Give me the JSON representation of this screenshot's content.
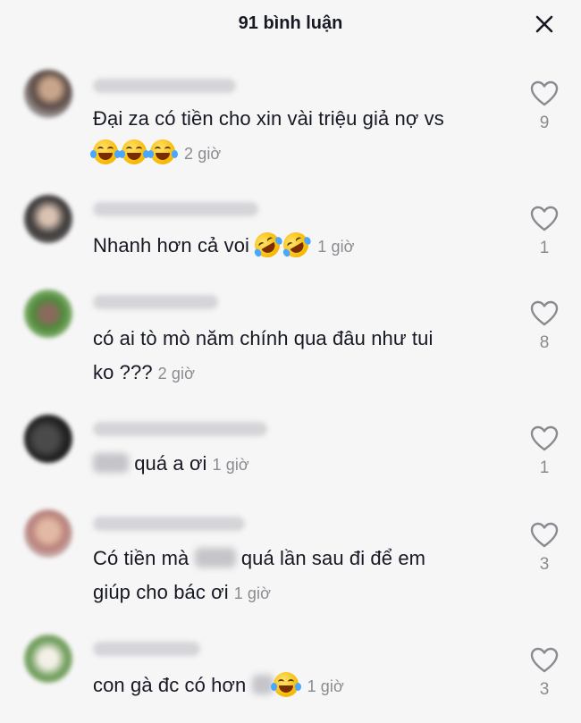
{
  "header": {
    "title": "91 bình luận",
    "close_icon": "close-icon"
  },
  "comments": [
    {
      "text": "Đại za có tiền cho xin vài triệu giả nợ vs",
      "emojis": [
        "face-with-tears-of-joy",
        "face-with-tears-of-joy",
        "face-with-tears-of-joy"
      ],
      "time": "2 giờ",
      "likes": "9"
    },
    {
      "text": "Nhanh hơn cả voi",
      "emojis": [
        "rolling-on-the-floor-laughing",
        "rolling-on-the-floor-laughing"
      ],
      "time": "1 giờ",
      "likes": "1"
    },
    {
      "text_line1": "có ai tò mò năm chính qua đâu như tui",
      "text_line2": "ko ???",
      "time": "2 giờ",
      "likes": "8"
    },
    {
      "text": "quá a ơi",
      "time": "1 giờ",
      "likes": "1"
    },
    {
      "text_part1": "Có tiền mà",
      "text_part2": "quá lần sau đi để em",
      "text_line2": "giúp cho bác ơi",
      "time": "1 giờ",
      "likes": "3"
    },
    {
      "text": "con gà đc có hơn",
      "emojis": [
        "face-with-tears-of-joy"
      ],
      "time": "1 giờ",
      "likes": "3"
    }
  ],
  "colors": {
    "background": "#f6f6f6",
    "text": "#161823",
    "secondary": "#8a8b91"
  }
}
